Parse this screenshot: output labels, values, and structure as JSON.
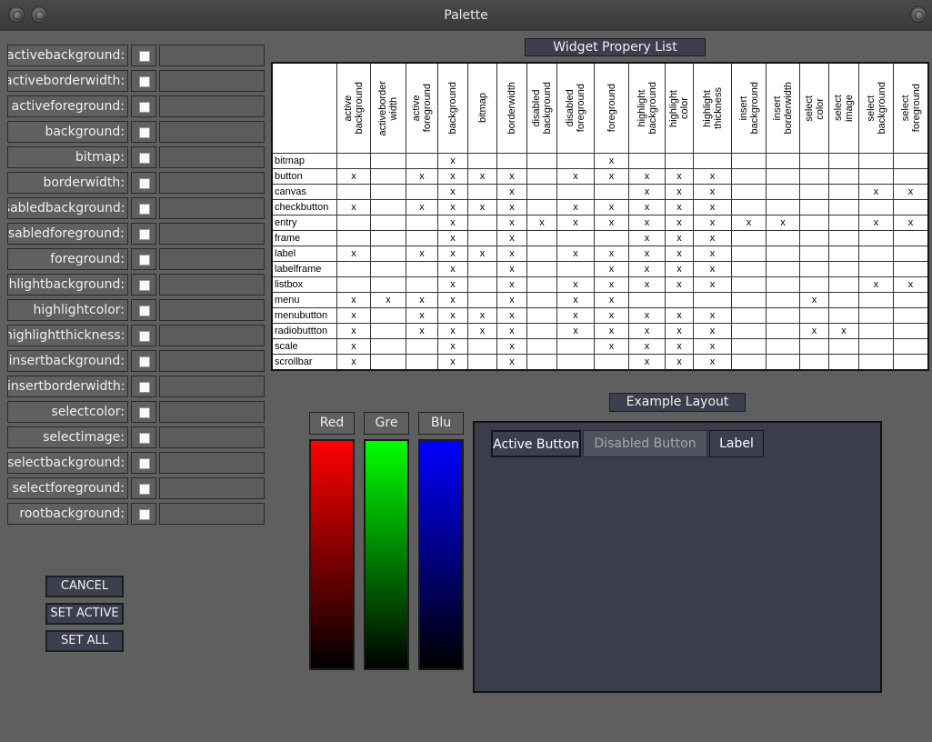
{
  "window": {
    "title": "Palette"
  },
  "properties": [
    "activebackground:",
    "activeborderwidth:",
    "activeforeground:",
    "background:",
    "bitmap:",
    "borderwidth:",
    "disabledbackground:",
    "disabledforeground:",
    "foreground:",
    "highlightbackground:",
    "highlightcolor:",
    "highlightthickness:",
    "insertbackground:",
    "insertborderwidth:",
    "selectcolor:",
    "selectimage:",
    "selectbackground:",
    "selectforeground:",
    "rootbackground:"
  ],
  "actions": {
    "cancel": "CANCEL",
    "set_active": "SET ACTIVE",
    "set_all": "SET ALL"
  },
  "widget_table": {
    "title": "Widget Propery List",
    "columns": [
      "active\nbackground",
      "activeborder\nwidth",
      "active\nforeground",
      "background",
      "bitmap",
      "borderwidth",
      "disabled\nbackground",
      "disabled\nforeground",
      "foreground",
      "highlight\nbackground",
      "highlight\ncolor",
      "highlight\nthickness",
      "insert\nbackground",
      "insert\nborderwidth",
      "select\ncolor",
      "select\nimage",
      "select\nbackground",
      "select\nforeground"
    ],
    "rows": [
      {
        "name": "bitmap",
        "cells": [
          "",
          "",
          "",
          "x",
          "",
          "",
          "",
          "",
          "x",
          "",
          "",
          "",
          "",
          "",
          "",
          "",
          "",
          ""
        ]
      },
      {
        "name": "button",
        "cells": [
          "x",
          "",
          "x",
          "x",
          "x",
          "x",
          "",
          "x",
          "x",
          "x",
          "x",
          "x",
          "",
          "",
          "",
          "",
          "",
          ""
        ]
      },
      {
        "name": "canvas",
        "cells": [
          "",
          "",
          "",
          "x",
          "",
          "x",
          "",
          "",
          "",
          "x",
          "x",
          "x",
          "",
          "",
          "",
          "",
          "x",
          "x"
        ]
      },
      {
        "name": "checkbutton",
        "cells": [
          "x",
          "",
          "x",
          "x",
          "x",
          "x",
          "",
          "x",
          "x",
          "x",
          "x",
          "x",
          "",
          "",
          "",
          "",
          "",
          ""
        ]
      },
      {
        "name": "entry",
        "cells": [
          "",
          "",
          "",
          "x",
          "",
          "x",
          "x",
          "x",
          "x",
          "x",
          "x",
          "x",
          "x",
          "x",
          "",
          "",
          "x",
          "x"
        ]
      },
      {
        "name": "frame",
        "cells": [
          "",
          "",
          "",
          "x",
          "",
          "x",
          "",
          "",
          "",
          "x",
          "x",
          "x",
          "",
          "",
          "",
          "",
          "",
          ""
        ]
      },
      {
        "name": "label",
        "cells": [
          "x",
          "",
          "x",
          "x",
          "x",
          "x",
          "",
          "x",
          "x",
          "x",
          "x",
          "x",
          "",
          "",
          "",
          "",
          "",
          ""
        ]
      },
      {
        "name": "labelframe",
        "cells": [
          "",
          "",
          "",
          "x",
          "",
          "x",
          "",
          "",
          "x",
          "x",
          "x",
          "x",
          "",
          "",
          "",
          "",
          "",
          ""
        ]
      },
      {
        "name": "listbox",
        "cells": [
          "",
          "",
          "",
          "x",
          "",
          "x",
          "",
          "x",
          "x",
          "x",
          "x",
          "x",
          "",
          "",
          "",
          "",
          "x",
          "x"
        ]
      },
      {
        "name": "menu",
        "cells": [
          "x",
          "x",
          "x",
          "x",
          "",
          "x",
          "",
          "x",
          "x",
          "",
          "",
          "",
          "",
          "",
          "x",
          "",
          "",
          ""
        ]
      },
      {
        "name": "menubutton",
        "cells": [
          "x",
          "",
          "x",
          "x",
          "x",
          "x",
          "",
          "x",
          "x",
          "x",
          "x",
          "x",
          "",
          "",
          "",
          "",
          "",
          ""
        ]
      },
      {
        "name": "radiobuttton",
        "cells": [
          "x",
          "",
          "x",
          "x",
          "x",
          "x",
          "",
          "x",
          "x",
          "x",
          "x",
          "x",
          "",
          "",
          "x",
          "x",
          "",
          ""
        ]
      },
      {
        "name": "scale",
        "cells": [
          "x",
          "",
          "",
          "x",
          "",
          "x",
          "",
          "",
          "x",
          "x",
          "x",
          "x",
          "",
          "",
          "",
          "",
          "",
          ""
        ]
      },
      {
        "name": "scrollbar",
        "cells": [
          "x",
          "",
          "",
          "x",
          "",
          "x",
          "",
          "",
          "",
          "x",
          "x",
          "x",
          "",
          "",
          "",
          "",
          "",
          ""
        ]
      }
    ]
  },
  "color_sliders": [
    {
      "label": "Red",
      "color": "#ff0000"
    },
    {
      "label": "Gre",
      "color": "#00ff00"
    },
    {
      "label": "Blu",
      "color": "#0000ff"
    }
  ],
  "example_layout": {
    "title": "Example Layout",
    "active_button": "Active Button",
    "disabled_button": "Disabled Button",
    "label": "Label",
    "background_color": "#3a3d4c"
  }
}
